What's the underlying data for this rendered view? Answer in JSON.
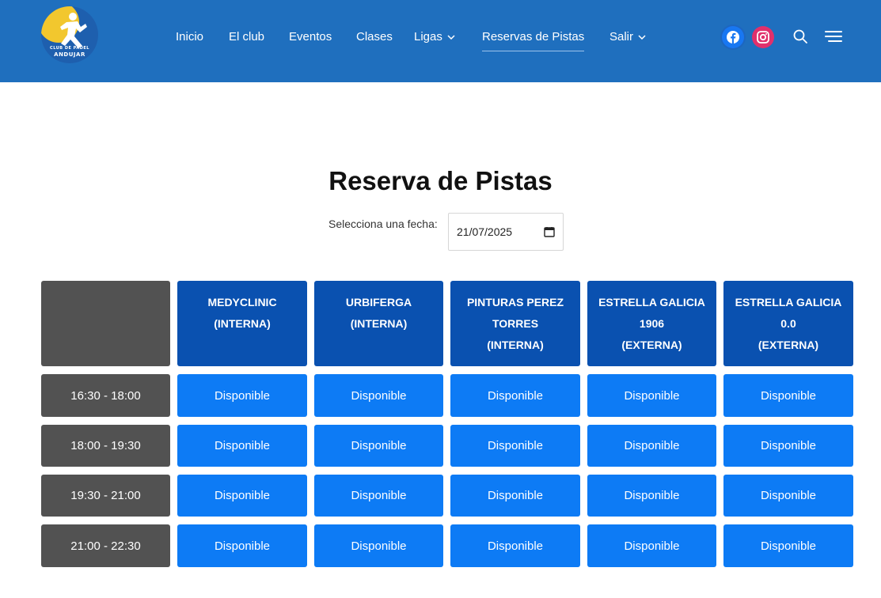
{
  "header": {
    "logo": {
      "text_small": "CLUB DE PADEL",
      "text_big": "ANDUJAR"
    },
    "nav": [
      {
        "label": "Inicio",
        "has_dropdown": false,
        "active": false
      },
      {
        "label": "El club",
        "has_dropdown": false,
        "active": false
      },
      {
        "label": "Eventos",
        "has_dropdown": false,
        "active": false
      },
      {
        "label": "Clases",
        "has_dropdown": false,
        "active": false
      },
      {
        "label": "Ligas",
        "has_dropdown": true,
        "active": false
      },
      {
        "label": "Reservas de Pistas",
        "has_dropdown": false,
        "active": true
      },
      {
        "label": "Salir",
        "has_dropdown": true,
        "active": false
      }
    ],
    "icons": [
      "facebook-icon",
      "instagram-icon",
      "search-icon",
      "menu-icon"
    ],
    "colors": {
      "header_bg": "#1f6fbe",
      "facebook": "#1877f2",
      "instagram": "#e1306c"
    }
  },
  "main": {
    "title": "Reserva de Pistas",
    "date_label": "Selecciona una fecha:",
    "date_value": "21/07/2025"
  },
  "table": {
    "courts": [
      "MEDYCLINIC\n(INTERNA)",
      "URBIFERGA\n(INTERNA)",
      "PINTURAS PEREZ\nTORRES\n(INTERNA)",
      "ESTRELLA GALICIA\n1906\n(EXTERNA)",
      "ESTRELLA GALICIA\n0.0\n(EXTERNA)"
    ],
    "slots": [
      {
        "time": "16:30 - 18:00",
        "status": [
          "Disponible",
          "Disponible",
          "Disponible",
          "Disponible",
          "Disponible"
        ]
      },
      {
        "time": "18:00 - 19:30",
        "status": [
          "Disponible",
          "Disponible",
          "Disponible",
          "Disponible",
          "Disponible"
        ]
      },
      {
        "time": "19:30 - 21:00",
        "status": [
          "Disponible",
          "Disponible",
          "Disponible",
          "Disponible",
          "Disponible"
        ]
      },
      {
        "time": "21:00 - 22:30",
        "status": [
          "Disponible",
          "Disponible",
          "Disponible",
          "Disponible",
          "Disponible"
        ]
      }
    ],
    "colors": {
      "court_header": "#0a51b0",
      "time_cell": "#525252",
      "available": "#0d7bf5"
    }
  }
}
